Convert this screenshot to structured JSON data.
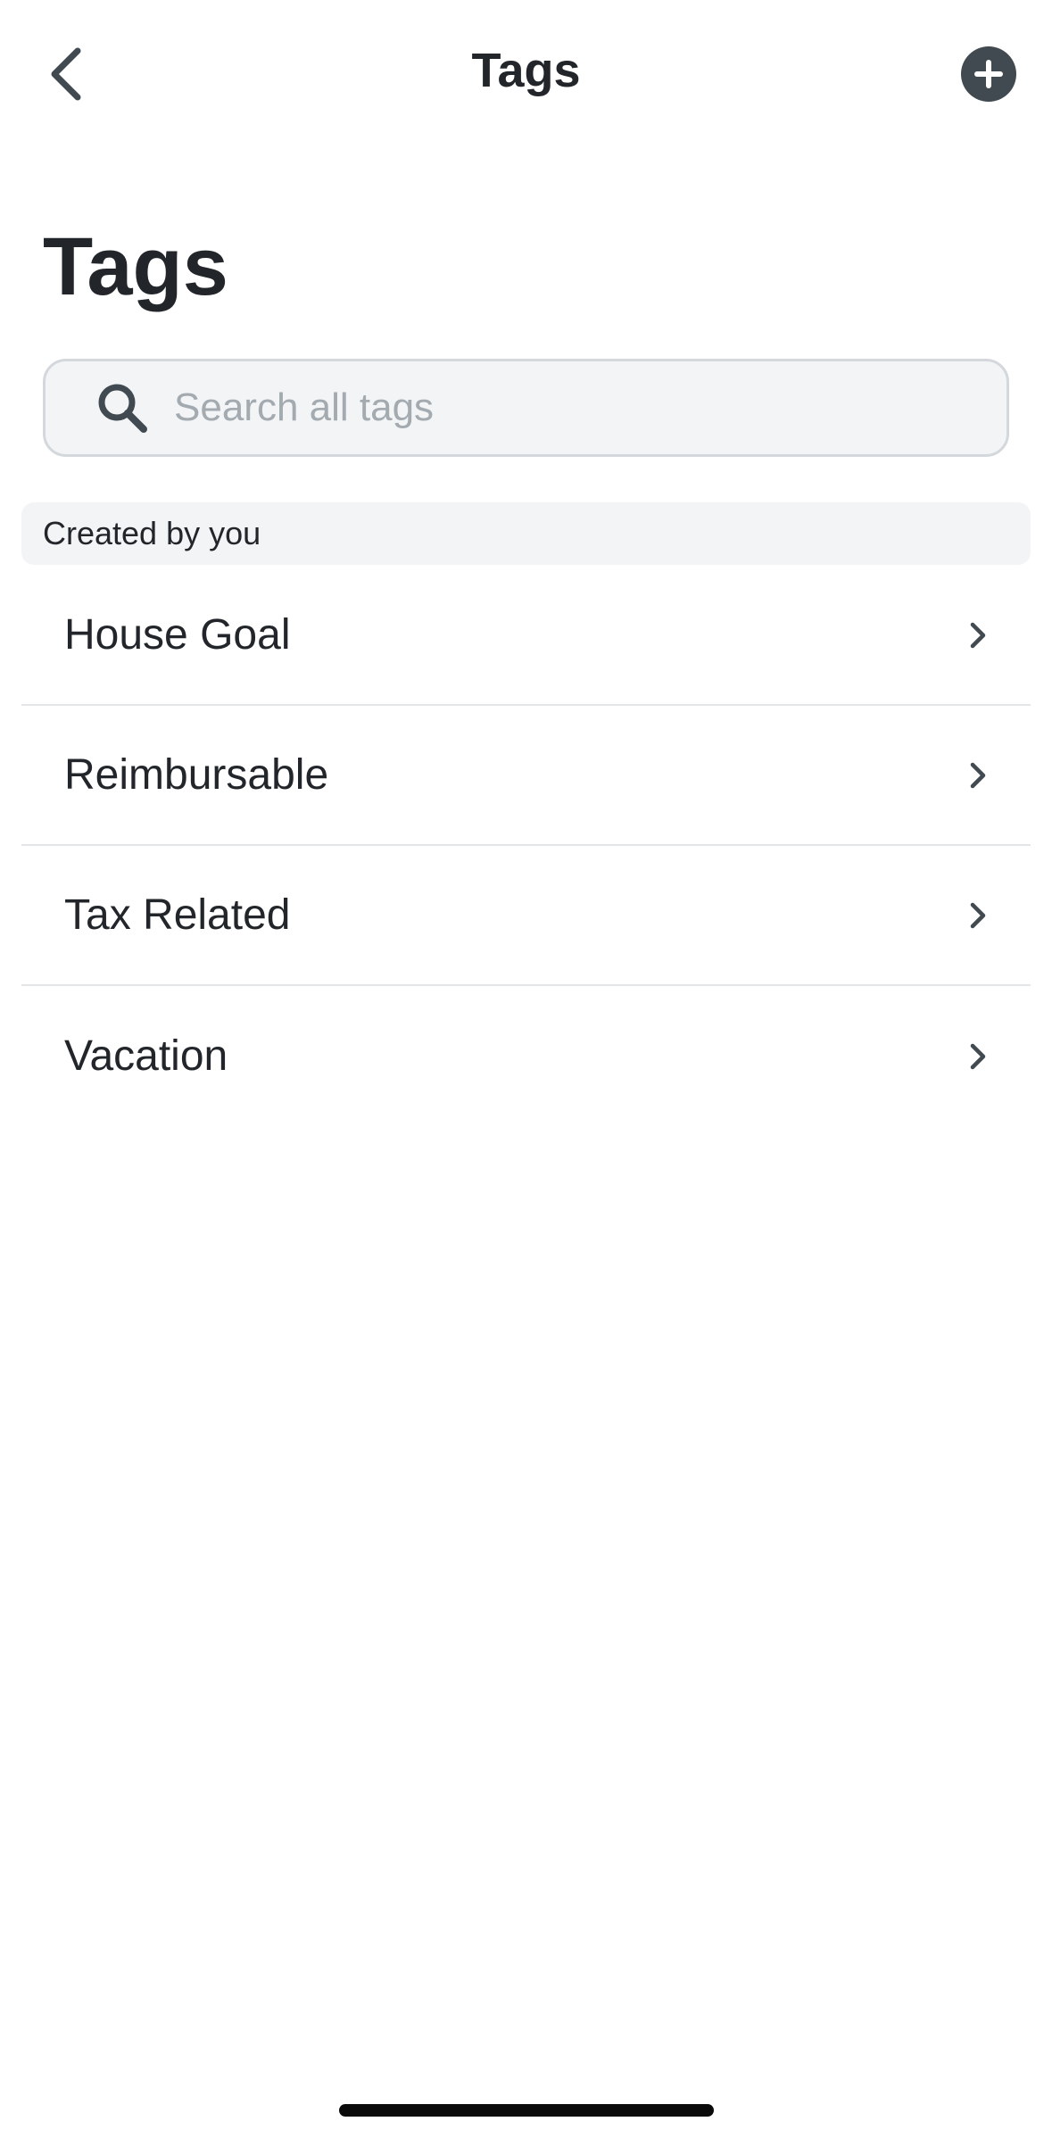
{
  "navbar": {
    "back_icon": "chevron-left-icon",
    "title": "Tags",
    "add_icon": "plus-circle-icon"
  },
  "page": {
    "title": "Tags"
  },
  "search": {
    "icon": "search-icon",
    "value": "",
    "placeholder": "Search all tags"
  },
  "section": {
    "header": "Created by you"
  },
  "tags": [
    {
      "label": "House Goal"
    },
    {
      "label": "Reimbursable"
    },
    {
      "label": "Tax Related"
    },
    {
      "label": "Vacation"
    }
  ],
  "colors": {
    "text": "#22262a",
    "icon": "#414a50",
    "section_bg": "#f2f4f6",
    "placeholder": "#a3aab0",
    "divider": "#e3e6e9"
  }
}
